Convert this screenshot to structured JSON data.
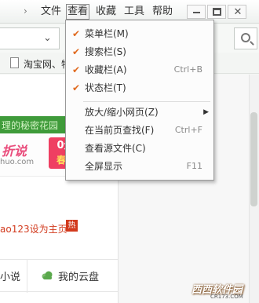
{
  "menubar": {
    "items": [
      "文件",
      "查看",
      "收藏",
      "工具",
      "帮助"
    ],
    "active_index": 1
  },
  "favorites_bar": {
    "item_label": "淘宝网、特"
  },
  "view_menu": {
    "items": [
      {
        "label": "菜单栏(M)",
        "checked": true,
        "shortcut": ""
      },
      {
        "label": "搜索栏(S)",
        "checked": true,
        "shortcut": ""
      },
      {
        "label": "收藏栏(A)",
        "checked": true,
        "shortcut": "Ctrl+B"
      },
      {
        "label": "状态栏(T)",
        "checked": true,
        "shortcut": ""
      },
      {
        "label": "放大/缩小网页(Z)",
        "checked": false,
        "shortcut": "",
        "has_submenu": true
      },
      {
        "label": "在当前页查找(F)",
        "checked": false,
        "shortcut": "Ctrl+F"
      },
      {
        "label": "查看源文件(C)",
        "checked": false,
        "shortcut": ""
      },
      {
        "label": "全屏显示",
        "checked": false,
        "shortcut": "F11"
      }
    ],
    "check_mark": "✔",
    "accent_color": "#e06a1f"
  },
  "page": {
    "banner_text": "理的秘密花园",
    "ad_brand": "折说",
    "ad_domain": "huo.com",
    "ad_promo_line1": "0元领",
    "ad_promo_line2": "春装狂",
    "home_link": "ao123设为主页",
    "hot_badge": "热",
    "tile_novel": "小说",
    "tile_cloud": "我的云盘",
    "banner_color": "#3f9b3a"
  },
  "watermark": {
    "text": "西西软件园",
    "sub": "CR173.COM"
  }
}
